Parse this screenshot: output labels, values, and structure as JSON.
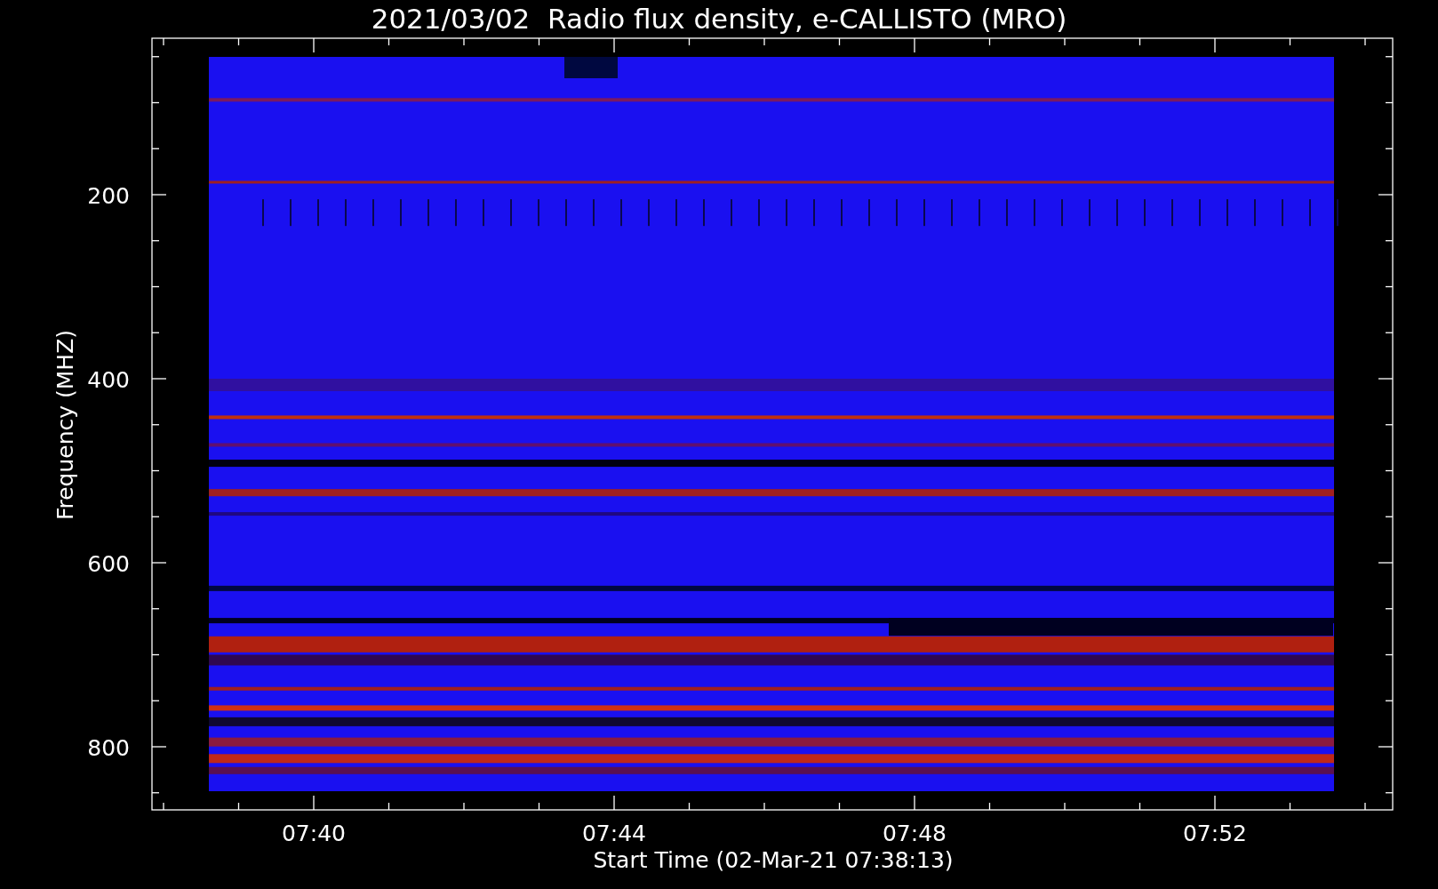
{
  "title": "2021/03/02  Radio flux density, e-CALLISTO (MRO)",
  "y_axis": {
    "label": "Frequency (MHZ)",
    "ticks": [
      "200",
      "400",
      "600",
      "800"
    ]
  },
  "x_axis": {
    "label": "Start Time (02-Mar-21 07:38:13)",
    "ticks": [
      "07:40",
      "07:44",
      "07:48",
      "07:52"
    ]
  }
}
